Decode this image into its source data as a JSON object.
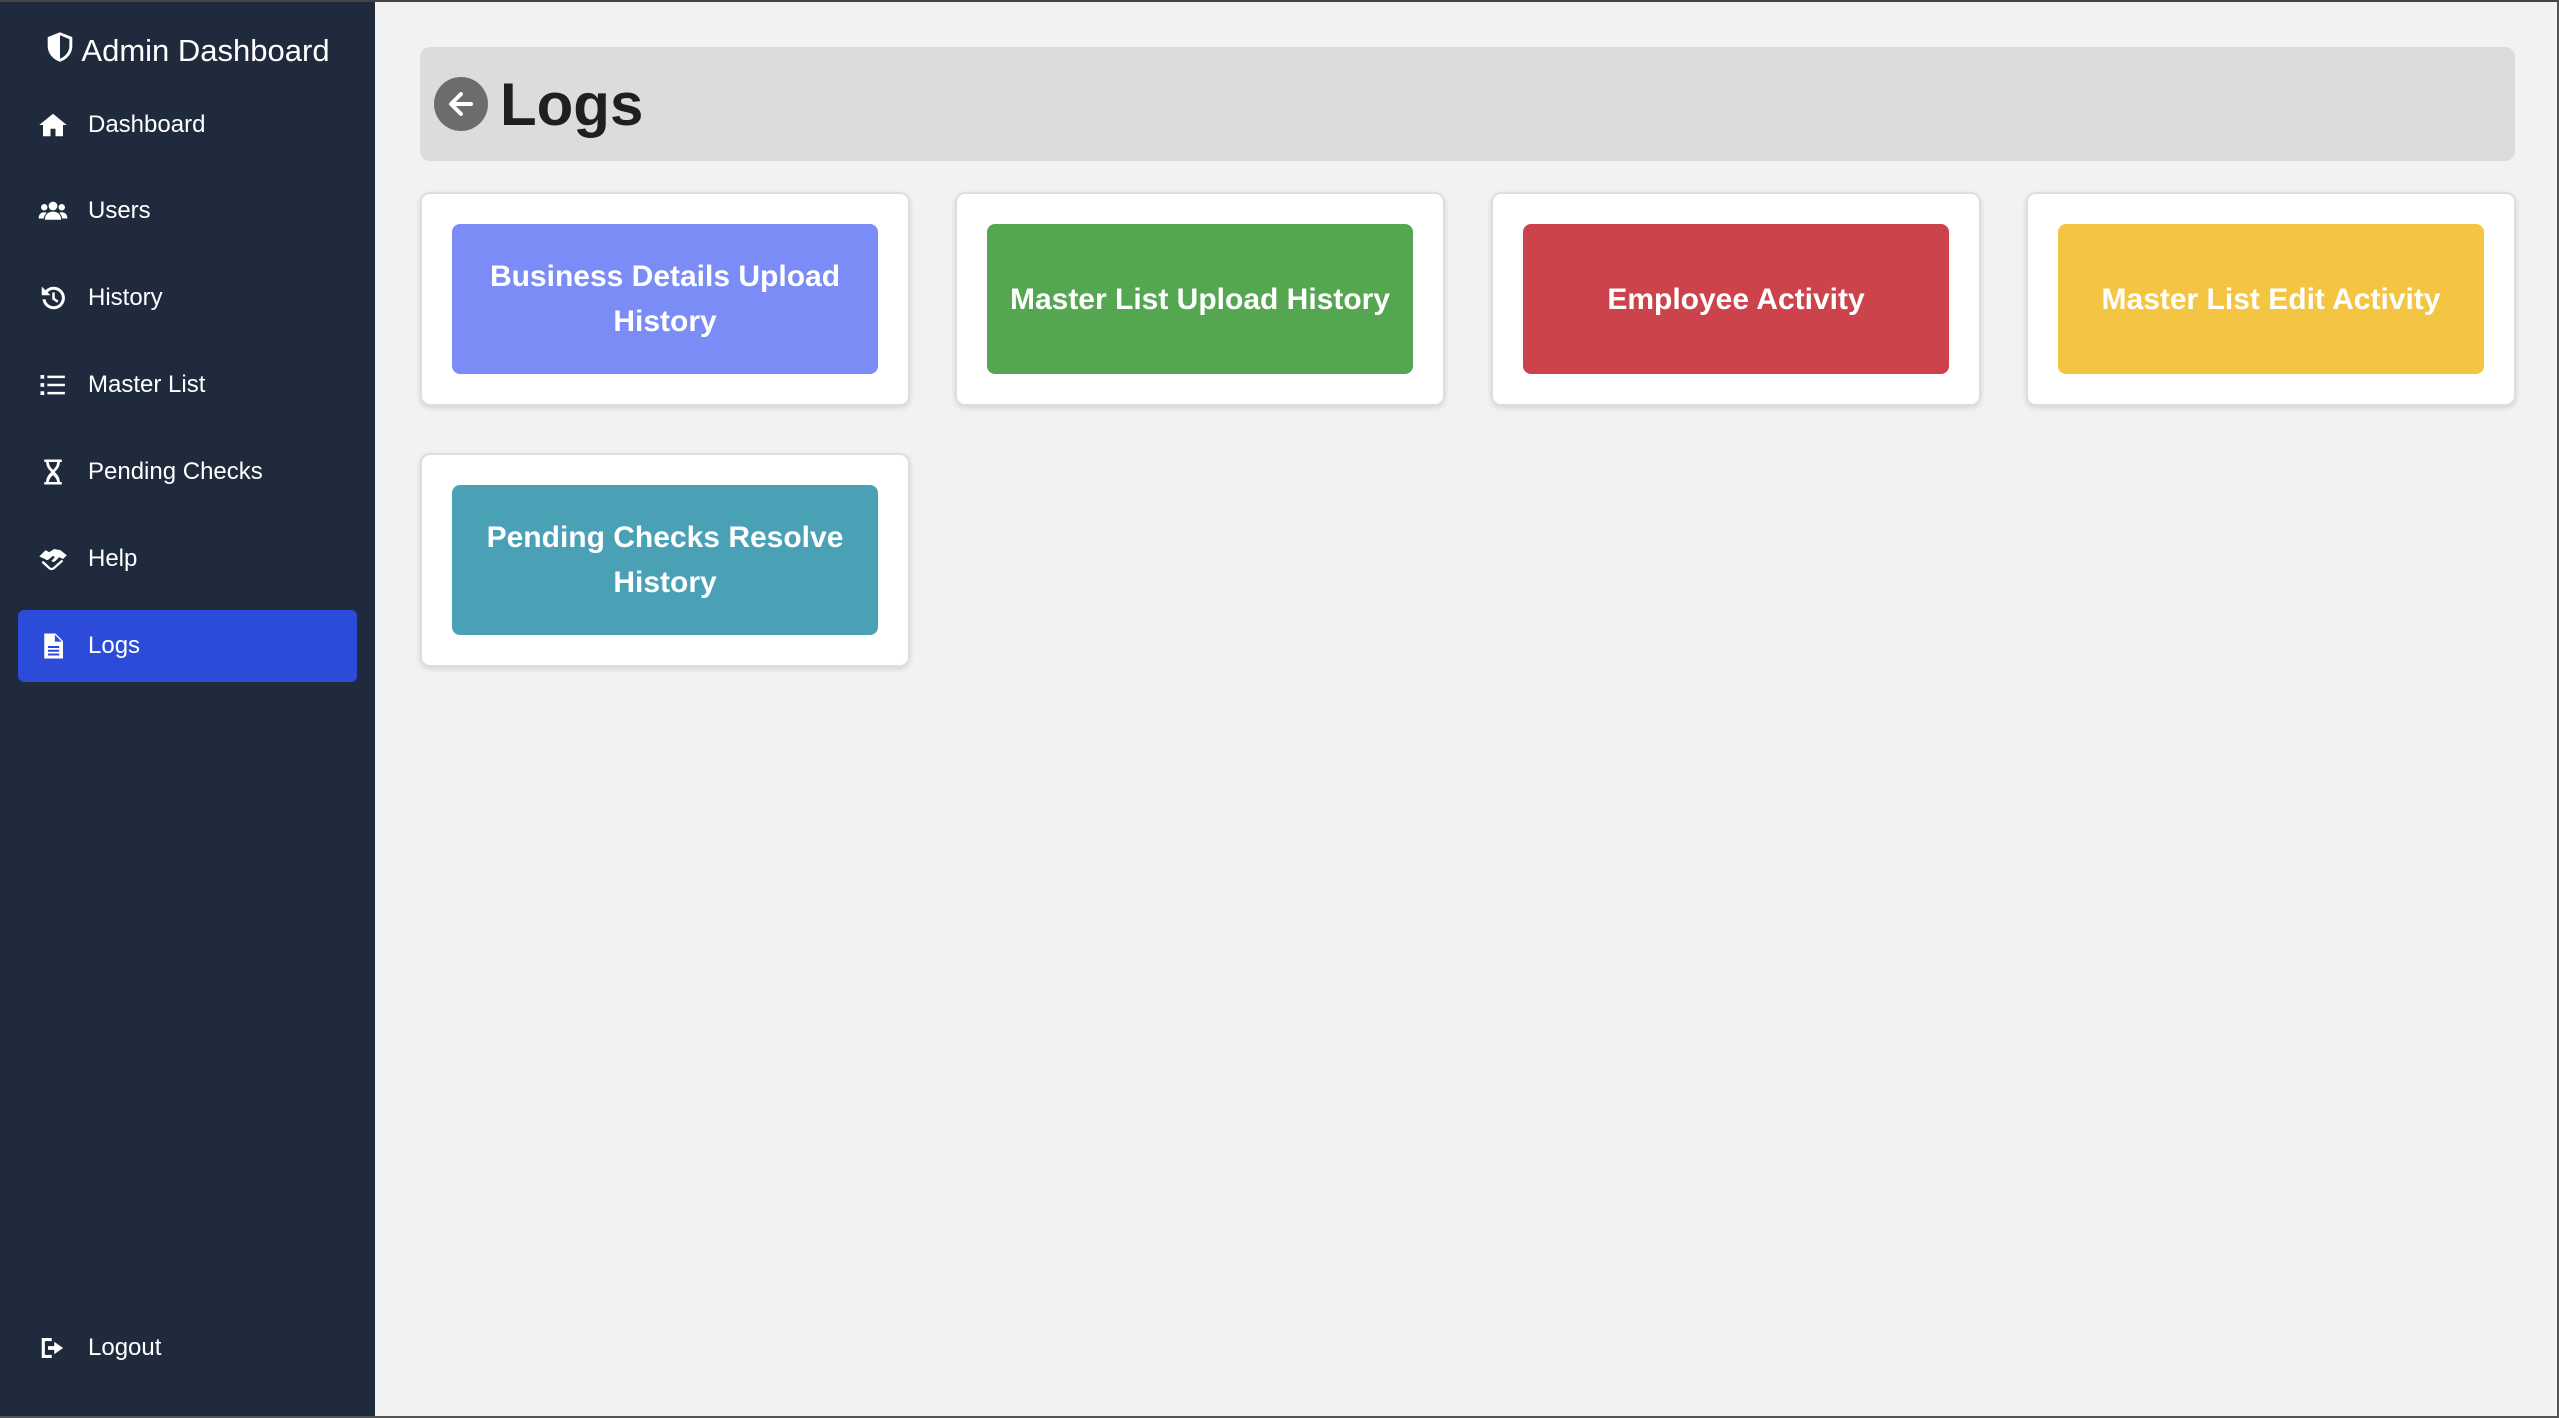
{
  "sidebar": {
    "brand": "Admin Dashboard",
    "items": [
      {
        "label": "Dashboard",
        "icon": "home-icon"
      },
      {
        "label": "Users",
        "icon": "users-icon"
      },
      {
        "label": "History",
        "icon": "history-icon"
      },
      {
        "label": "Master List",
        "icon": "list-icon"
      },
      {
        "label": "Pending Checks",
        "icon": "hourglass-icon"
      },
      {
        "label": "Help",
        "icon": "handshake-icon"
      },
      {
        "label": "Logs",
        "icon": "file-icon",
        "active": true
      }
    ],
    "logout": "Logout"
  },
  "header": {
    "title": "Logs"
  },
  "tiles": [
    {
      "label": "Business Details Upload History",
      "color": "#7b8cf7"
    },
    {
      "label": "Master List Upload History",
      "color": "#55a651"
    },
    {
      "label": "Employee Activity",
      "color": "#cc434c"
    },
    {
      "label": "Master List Edit Activity",
      "color": "#f4c443"
    },
    {
      "label": "Pending Checks Resolve History",
      "color": "#4aa1b6"
    }
  ],
  "colors": {
    "sidebar_bg": "#1f2a3d",
    "active_item": "#2b4bd8",
    "page_bg": "#f2f2f2",
    "header_bg": "#dcdcdc"
  }
}
